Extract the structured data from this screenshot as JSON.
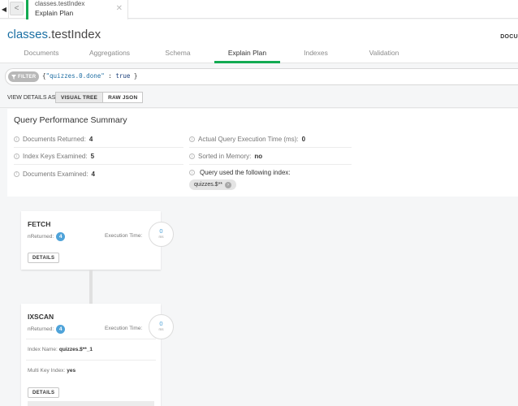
{
  "tabstrip": {
    "back_left": "◀",
    "back": "<",
    "active_tab": {
      "title": "classes.testIndex",
      "subtitle": "Explain Plan",
      "close": "✕"
    }
  },
  "header": {
    "ns_db": "classes",
    "ns_coll": ".testIndex",
    "right_label": "DOCU",
    "tabs": [
      {
        "label": "Documents"
      },
      {
        "label": "Aggregations"
      },
      {
        "label": "Schema"
      },
      {
        "label": "Explain Plan",
        "active": true
      },
      {
        "label": "Indexes"
      },
      {
        "label": "Validation"
      }
    ]
  },
  "filter": {
    "pill_label": "FILTER",
    "query_open": "{",
    "query_key": "\"quizzes.0.done\"",
    "query_sep": " : ",
    "query_val": "true",
    "query_close": " }"
  },
  "view_details": {
    "label": "VIEW DETAILS AS",
    "options": [
      {
        "label": "VISUAL TREE",
        "active": true
      },
      {
        "label": "RAW JSON",
        "active": false
      }
    ]
  },
  "summary": {
    "title": "Query Performance Summary",
    "info_glyph": "i",
    "docs_returned_label": "Documents Returned:",
    "docs_returned": "4",
    "index_keys_label": "Index Keys Examined:",
    "index_keys": "5",
    "docs_examined_label": "Documents Examined:",
    "docs_examined": "4",
    "exec_time_label": "Actual Query Execution Time (ms):",
    "exec_time": "0",
    "sorted_label": "Sorted in Memory:",
    "sorted": "no",
    "index_used_label": "Query used the following index:",
    "index_name": "quizzes.$**"
  },
  "stages": [
    {
      "name": "FETCH",
      "nreturned_label": "nReturned:",
      "nreturned": "4",
      "exec_label": "Execution Time:",
      "exec_ms": "0",
      "unit": "ms",
      "details_label": "DETAILS"
    },
    {
      "name": "IXSCAN",
      "nreturned_label": "nReturned:",
      "nreturned": "4",
      "exec_label": "Execution Time:",
      "exec_ms": "0",
      "unit": "ms",
      "index_name_label": "Index Name:",
      "index_name": "quizzes.$**_1",
      "multikey_label": "Multi Key Index:",
      "multikey": "yes",
      "details_label": "DETAILS"
    }
  ],
  "colors": {
    "accent_green": "#13aa52",
    "link_blue": "#1a6fa3",
    "badge_blue": "#4fa3d9"
  }
}
